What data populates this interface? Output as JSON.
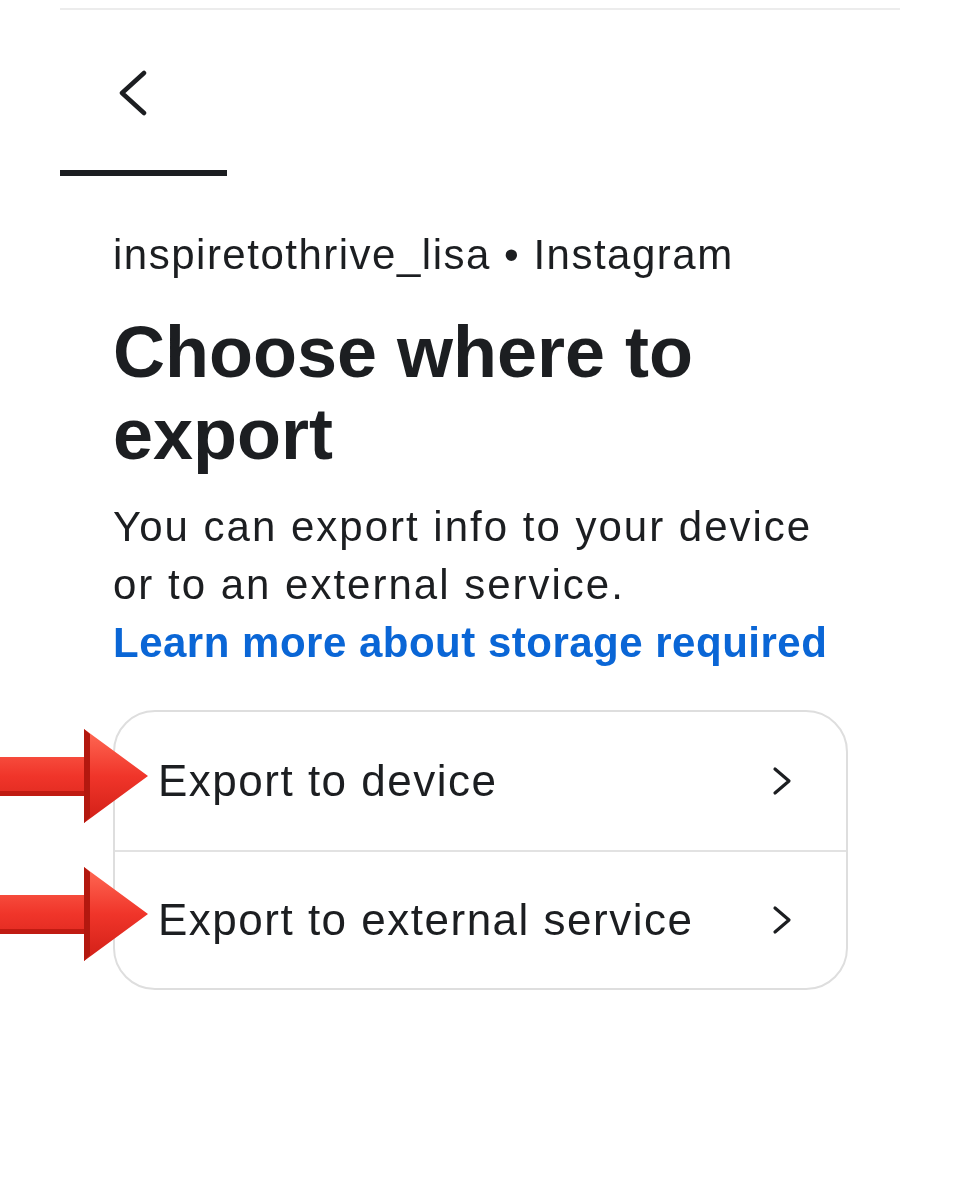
{
  "header": {
    "account": "inspiretothrive_lisa • Instagram"
  },
  "title": "Choose where to export",
  "description": {
    "text": "You can export info to your device or to an external service.",
    "link": "Learn more about storage required"
  },
  "options": [
    {
      "label": "Export to device",
      "highlighted": true
    },
    {
      "label": "Export to external service",
      "highlighted": true
    }
  ]
}
